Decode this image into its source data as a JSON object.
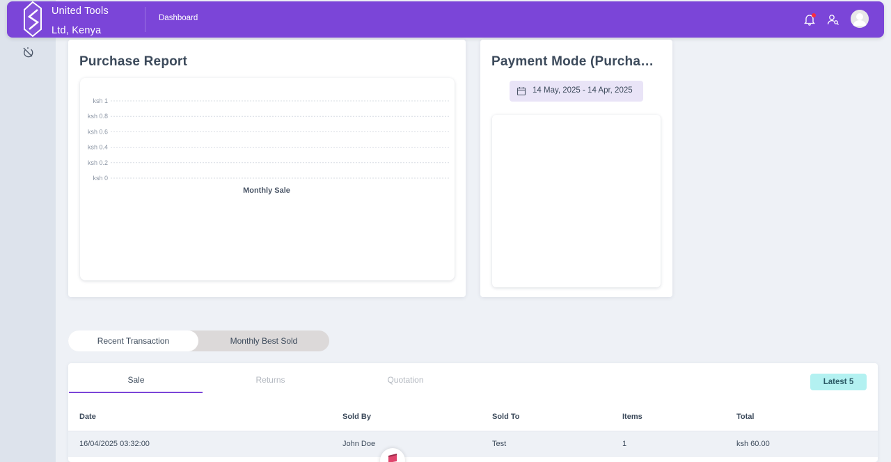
{
  "header": {
    "company_line1": "United Tools",
    "company_line2": "Ltd, Kenya",
    "nav_dashboard": "Dashboard",
    "icons": [
      "logo",
      "bell-icon",
      "user-search-icon",
      "avatar"
    ],
    "accent_color": "#7b45d8",
    "notification_dot_color": "#ff2a3d"
  },
  "sidebar": {
    "icons": [
      "timer-off-icon"
    ]
  },
  "purchase_report": {
    "title": "Purchase Report",
    "chart_data": {
      "type": "bar",
      "categories": [],
      "values": [],
      "xlabel": "Monthly Sale",
      "ylabel": "",
      "ylim": [
        0,
        1
      ],
      "yticks": [
        "ksh 1",
        "ksh 0.8",
        "ksh 0.6",
        "ksh 0.4",
        "ksh 0.2",
        "ksh 0"
      ],
      "grid": true
    }
  },
  "payment_mode": {
    "title": "Payment Mode (Purchase)",
    "date_range": "14 May, 2025 - 14 Apr, 2025"
  },
  "transactions_toggle": {
    "active": "Recent Transaction",
    "inactive": "Monthly Best Sold"
  },
  "transactions": {
    "tabs": [
      "Sale",
      "Returns",
      "Quotation"
    ],
    "active_tab": "Sale",
    "badge": "Latest 5",
    "columns": [
      "Date",
      "Sold By",
      "Sold To",
      "Items",
      "Total"
    ],
    "rows": [
      {
        "date": "16/04/2025 03:32:00",
        "sold_by": "John Doe",
        "sold_to": "Test",
        "items": "1",
        "total": "ksh 60.00"
      }
    ]
  }
}
